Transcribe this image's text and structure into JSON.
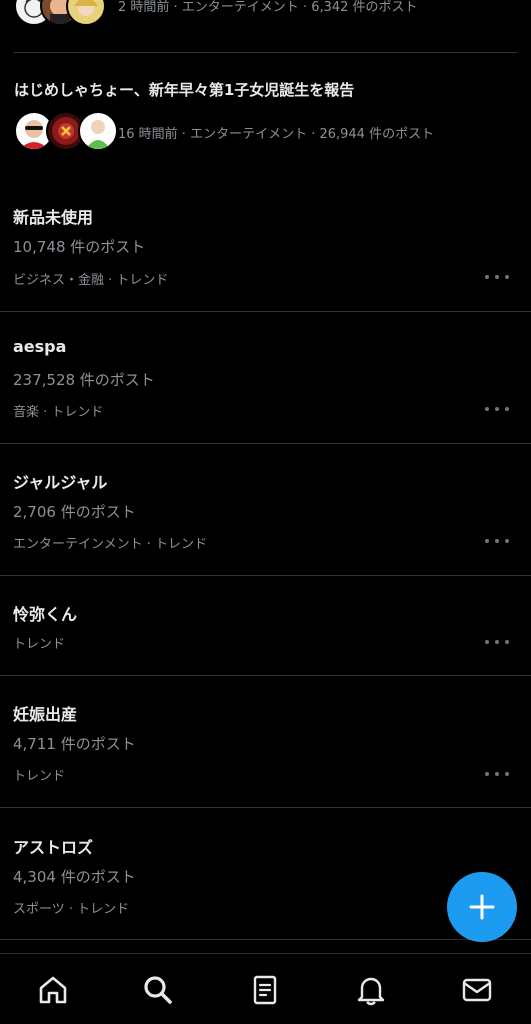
{
  "top_story": {
    "meta": "2 時間前 · エンターテイメント · 6,342 件のポスト",
    "avatar_icons": [
      "avatar-illustration-icon",
      "avatar-woman-icon",
      "avatar-blonde-icon"
    ]
  },
  "news_story": {
    "headline": "はじめしゃちょー、新年早々第1子女児誕生を報告",
    "meta": "16 時間前 · エンターテイメント · 26,944 件のポスト",
    "avatar_icons": [
      "avatar-man-icon",
      "avatar-red-logo-icon",
      "avatar-green-character-icon"
    ]
  },
  "trends": [
    {
      "title": "新品未使用",
      "count": "10,748 件のポスト",
      "category": "ビジネス・金融 · トレンド"
    },
    {
      "title": "aespa",
      "count": "237,528 件のポスト",
      "category": "音楽 · トレンド"
    },
    {
      "title": "ジャルジャル",
      "count": "2,706 件のポスト",
      "category": "エンターテインメント · トレンド"
    },
    {
      "title": "怜弥くん",
      "count": "",
      "category": "トレンド"
    },
    {
      "title": "妊娠出産",
      "count": "4,711 件のポスト",
      "category": "トレンド"
    },
    {
      "title": "アストロズ",
      "count": "4,304 件のポスト",
      "category": "スポーツ · トレンド"
    }
  ],
  "fab": {
    "icon": "plus-icon",
    "color": "#1d9bf0"
  },
  "bottom_nav": {
    "items": [
      {
        "icon": "home-icon"
      },
      {
        "icon": "search-icon"
      },
      {
        "icon": "notes-icon"
      },
      {
        "icon": "bell-icon"
      },
      {
        "icon": "mail-icon"
      }
    ]
  },
  "colors": {
    "background": "#000000",
    "text_primary": "#e7e9ea",
    "text_secondary": "#8b9196",
    "divider": "#2f3336",
    "accent": "#1d9bf0"
  }
}
